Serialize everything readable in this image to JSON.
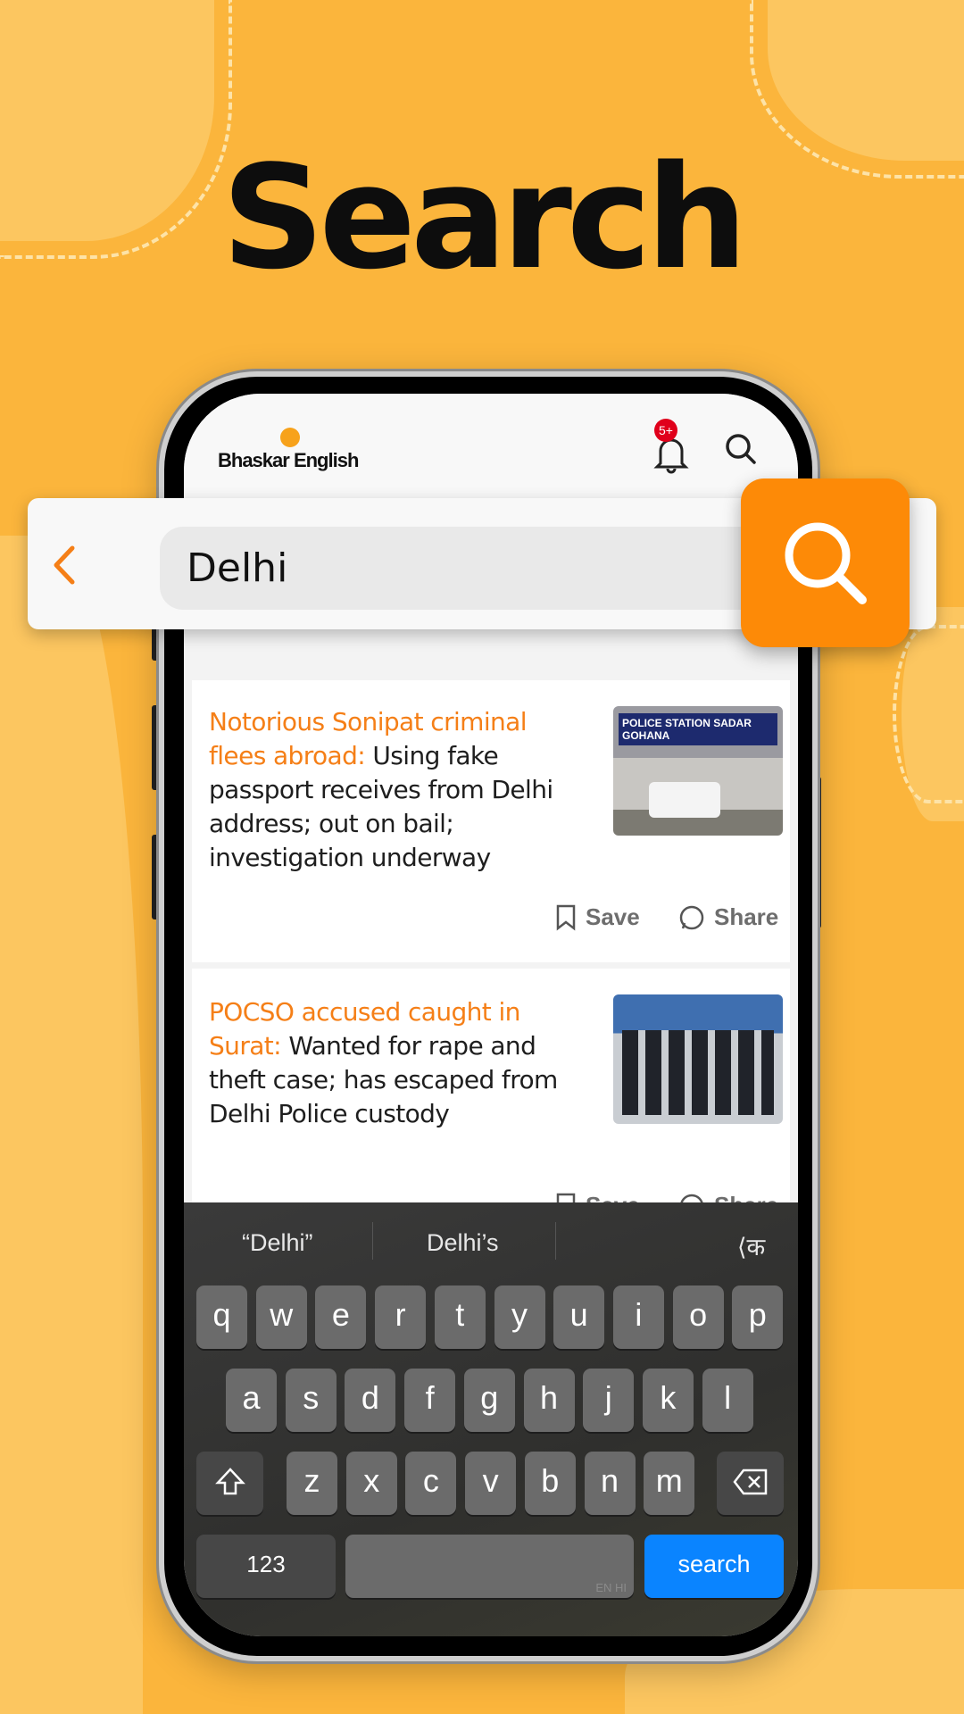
{
  "promo_title": "Search",
  "app": {
    "logo_text": "Bhaskar English",
    "notification_badge": "5+",
    "accent_color": "#f57f17",
    "brand_orange": "#fd8a07"
  },
  "search": {
    "query": "Delhi",
    "back_icon": "chevron-left-icon",
    "button_icon": "search-icon"
  },
  "articles": [
    {
      "headline_accent": "Notorious Sonipat criminal flees abroad:",
      "headline_rest": " Using fake passport receives from Delhi address; out on bail; investigation underway",
      "image_caption": "POLICE STATION SADAR GOHANA",
      "save_label": "Save",
      "share_label": "Share"
    },
    {
      "headline_accent": "POCSO accused caught in Surat:",
      "headline_rest": " Wanted for rape and theft case; has escaped from Delhi Police custody",
      "save_label": "Save",
      "share_label": "Share"
    }
  ],
  "keyboard": {
    "suggestions": [
      "“Delhi”",
      "Delhi’s",
      "⟨क"
    ],
    "rows": [
      [
        "q",
        "w",
        "e",
        "r",
        "t",
        "y",
        "u",
        "i",
        "o",
        "p"
      ],
      [
        "a",
        "s",
        "d",
        "f",
        "g",
        "h",
        "j",
        "k",
        "l"
      ],
      [
        "z",
        "x",
        "c",
        "v",
        "b",
        "n",
        "m"
      ]
    ],
    "numbers_label": "123",
    "space_hint": "EN HI",
    "action_label": "search",
    "action_color": "#0a84ff"
  }
}
